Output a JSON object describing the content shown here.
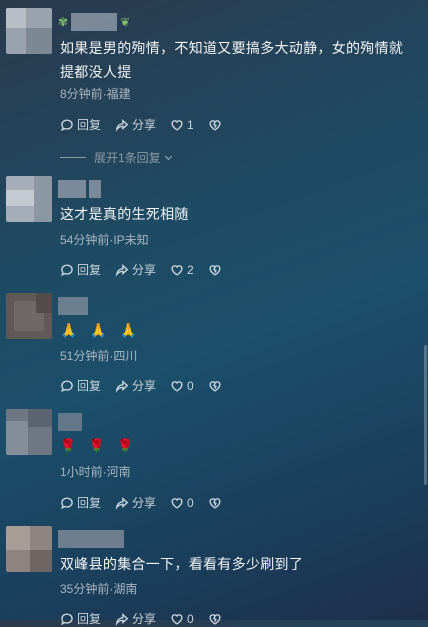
{
  "comments": [
    {
      "text": "如果是男的殉情，不知道又要搞多大动静，女的殉情就提都没人提",
      "meta": "8分钟前·福建",
      "reply_label": "回复",
      "share_label": "分享",
      "like_count": "1",
      "expand_label": "展开1条回复"
    },
    {
      "text": "这才是真的生死相随",
      "meta": "54分钟前·IP未知",
      "reply_label": "回复",
      "share_label": "分享",
      "like_count": "2"
    },
    {
      "emojis": [
        "🙏",
        "🙏",
        "🙏"
      ],
      "meta": "51分钟前·四川",
      "reply_label": "回复",
      "share_label": "分享",
      "like_count": "0"
    },
    {
      "emojis": [
        "🌹",
        "🌹",
        "🌹"
      ],
      "meta": "1小时前·河南",
      "reply_label": "回复",
      "share_label": "分享",
      "like_count": "0"
    },
    {
      "text": "双峰县的集合一下，看看有多少刷到了",
      "meta": "35分钟前·湖南",
      "reply_label": "回复",
      "share_label": "分享",
      "like_count": "0"
    }
  ],
  "icons": {
    "reply": "comment-bubble-icon",
    "share": "share-arrow-icon",
    "like": "heart-icon",
    "dislike": "broken-heart-icon",
    "expand": "chevron-down-icon"
  }
}
